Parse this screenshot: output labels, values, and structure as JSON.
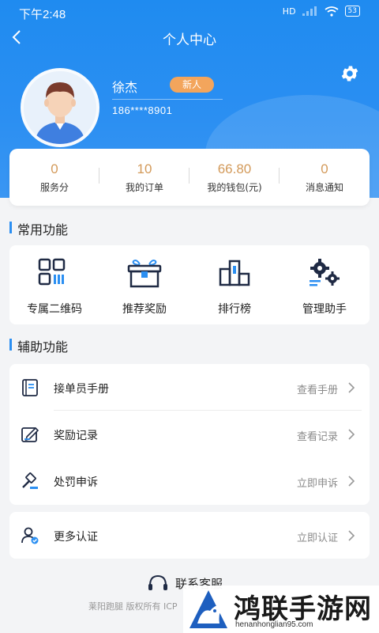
{
  "status_bar": {
    "time": "下午2:48",
    "network": "HD",
    "battery": "53"
  },
  "nav": {
    "title": "个人中心",
    "back_icon": "chevron-left-icon"
  },
  "profile": {
    "name": "徐杰",
    "badge": "新人",
    "phone": "186****8901",
    "settings_icon": "gear-icon"
  },
  "colors": {
    "primary": "#2b8ff2",
    "accent": "#d39a5a",
    "badge": "#f3a55c"
  },
  "stats": [
    {
      "value": "0",
      "label": "服务分"
    },
    {
      "value": "10",
      "label": "我的订单"
    },
    {
      "value": "66.80",
      "label": "我的钱包(元)"
    },
    {
      "value": "0",
      "label": "消息通知"
    }
  ],
  "common": {
    "title": "常用功能",
    "items": [
      {
        "label": "专属二维码",
        "icon": "qrcode-icon"
      },
      {
        "label": "推荐奖励",
        "icon": "gift-icon"
      },
      {
        "label": "排行榜",
        "icon": "ranking-icon"
      },
      {
        "label": "管理助手",
        "icon": "gears-icon"
      }
    ]
  },
  "aux": {
    "title": "辅助功能",
    "items": [
      {
        "label": "接单员手册",
        "action": "查看手册",
        "icon": "handbook-icon"
      },
      {
        "label": "奖励记录",
        "action": "查看记录",
        "icon": "edit-icon"
      },
      {
        "label": "处罚申诉",
        "action": "立即申诉",
        "icon": "gavel-icon"
      }
    ]
  },
  "more": {
    "label": "更多认证",
    "action": "立即认证",
    "icon": "user-verified-icon"
  },
  "footer": {
    "contact": "联系客服",
    "copyright": "莱阳跑腿 版权所有 ICP"
  },
  "watermark": {
    "title": "鸿联手游网",
    "url": "henanhonglian95.com"
  }
}
